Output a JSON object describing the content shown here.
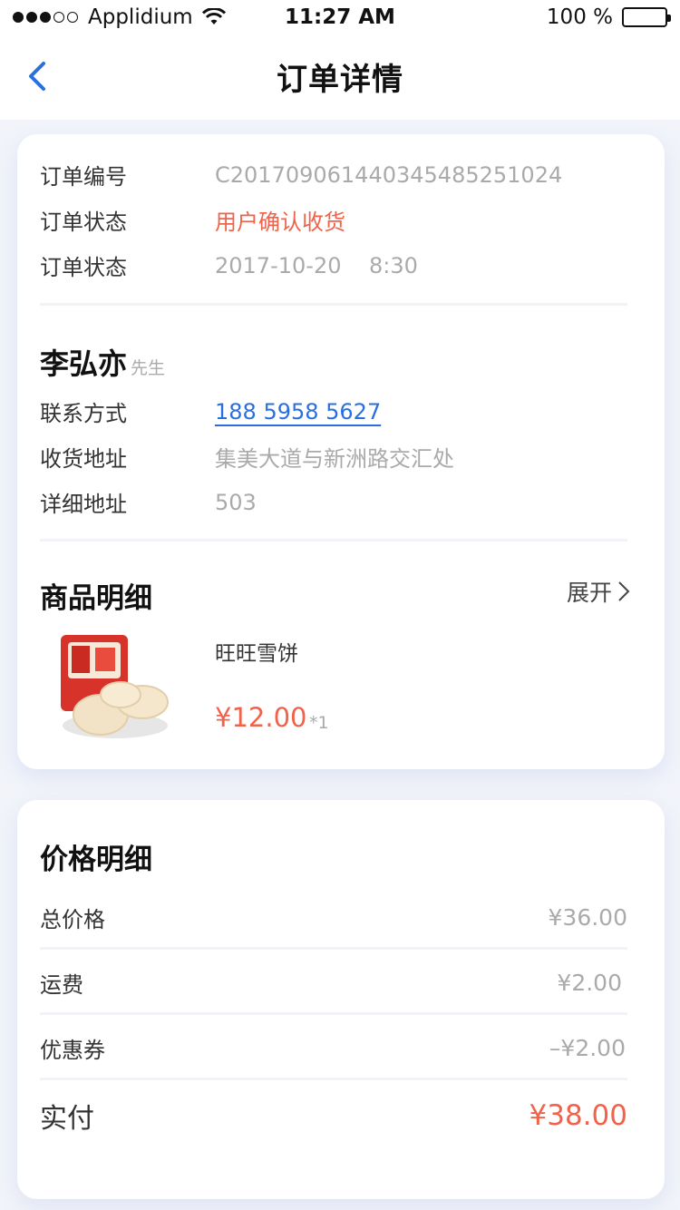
{
  "status_bar": {
    "carrier": "Applidium",
    "time": "11:27 AM",
    "battery": "100 %"
  },
  "nav": {
    "title": "订单详情"
  },
  "order": {
    "number_label": "订单编号",
    "number_value": "C2017090614403454852510​24",
    "status_label": "订单状态",
    "status_value": "用户确认收货",
    "time_label": "订单状态",
    "time_value": "2017-10-20    8:30"
  },
  "contact": {
    "name": "李弘亦",
    "title": "先生",
    "phone_label": "联系方式",
    "phone_value": "188 5958 5627",
    "address_label": "收货地址",
    "address_value": "集美大道与新洲路交汇处",
    "detail_label": "详细地址",
    "detail_value": "503"
  },
  "goods": {
    "title": "商品明细",
    "expand": "展开",
    "item_name": "旺旺雪饼",
    "item_price": "¥12.00",
    "item_qty": "*1"
  },
  "price": {
    "title": "价格明细",
    "total_label": "总价格",
    "total_value": "¥36.00",
    "shipping_label": "运费",
    "shipping_value": "¥2.00",
    "coupon_label": "优惠券",
    "coupon_value": "–¥2.00",
    "paid_label": "实付",
    "paid_value": "¥38.00"
  },
  "colors": {
    "accent_red": "#f0634a",
    "link_blue": "#2a6fe0"
  }
}
